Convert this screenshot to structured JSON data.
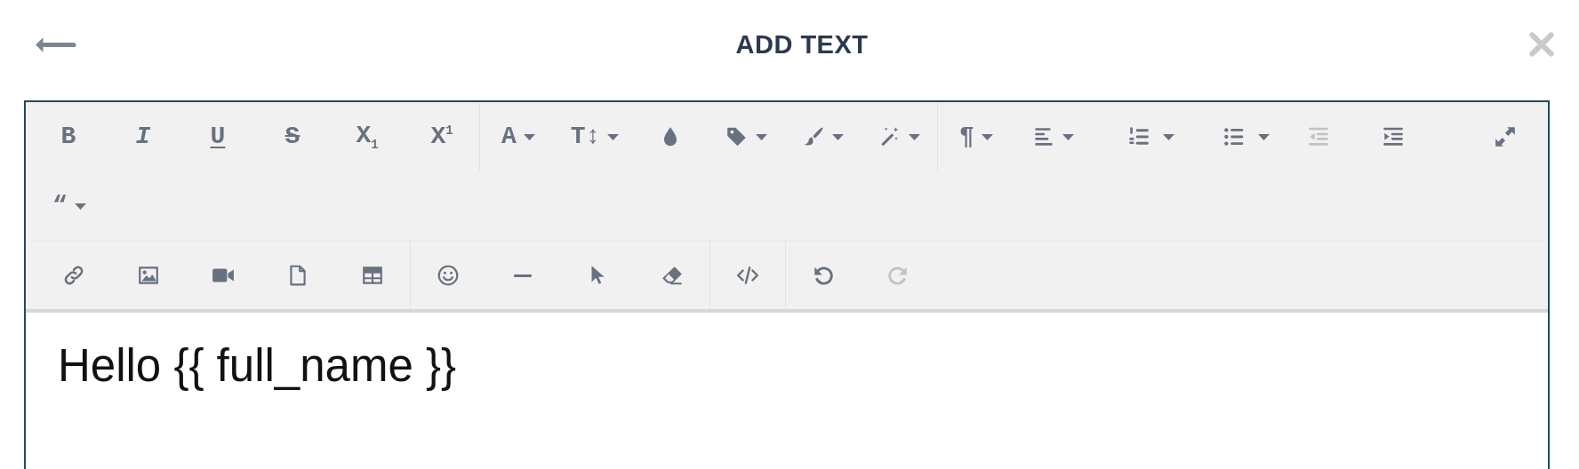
{
  "header": {
    "title": "ADD TEXT"
  },
  "toolbar": {
    "bars": [
      {
        "lines": [
          {
            "groups": [
              {
                "kind": "leading",
                "items": [
                  {
                    "kind": "bold",
                    "label": "B",
                    "menu": false,
                    "split": false,
                    "disabled": false
                  },
                  {
                    "kind": "italic",
                    "label": "I",
                    "menu": false,
                    "split": false,
                    "disabled": false
                  },
                  {
                    "kind": "underline",
                    "label": "U",
                    "menu": false,
                    "split": false,
                    "disabled": false
                  },
                  {
                    "kind": "strike",
                    "label": "S",
                    "menu": false,
                    "split": false,
                    "disabled": false
                  },
                  {
                    "kind": "glyph",
                    "label": "X$_{1}$",
                    "menu": false,
                    "split": false,
                    "disabled": false
                  },
                  {
                    "kind": "glyph",
                    "label": "X$^{1}$",
                    "menu": false,
                    "split": false,
                    "disabled": false
                  }
                ]
              },
              {
                "kind": "leading",
                "items": [
                  {
                    "kind": "glyph",
                    "label": "A",
                    "menu": true,
                    "split": false,
                    "disabled": false
                  },
                  {
                    "kind": "glyph",
                    "label": "T↕",
                    "menu": true,
                    "split": false,
                    "disabled": false
                  },
                  {
                    "kind": "icon",
                    "menu": false,
                    "split": false,
                    "disabled": false
                  },
                  {
                    "kind": "icon",
                    "menu": true,
                    "split": false,
                    "disabled": false
                  },
                  {
                    "kind": "icon",
                    "menu": true,
                    "split": false,
                    "disabled": false
                  },
                  {
                    "kind": "icon",
                    "menu": true,
                    "split": false,
                    "disabled": false
                  }
                ]
              },
              {
                "kind": "leading",
                "items": [
                  {
                    "kind": "glyph",
                    "label": "¶",
                    "menu": true,
                    "split": false,
                    "disabled": false
                  },
                  {
                    "kind": "icon",
                    "menu": true,
                    "split": false,
                    "disabled": false
                  },
                  {
                    "kind": "icon",
                    "menu": true,
                    "split": true,
                    "disabled": false
                  },
                  {
                    "kind": "icon",
                    "menu": true,
                    "split": true,
                    "disabled": false
                  },
                  {
                    "kind": "icon",
                    "menu": false,
                    "split": false,
                    "disabled": true
                  },
                  {
                    "kind": "icon",
                    "menu": false,
                    "split": false,
                    "disabled": false
                  }
                ]
              },
              {
                "kind": "trailing",
                "items": [
                  {
                    "kind": "icon",
                    "menu": false,
                    "split": false,
                    "disabled": false
                  }
                ]
              }
            ]
          },
          {
            "groups": [
              {
                "kind": "leading",
                "items": [
                  {
                    "kind": "bold",
                    "label": "“",
                    "menu": true,
                    "split": false,
                    "disabled": false
                  }
                ]
              }
            ]
          }
        ]
      },
      {
        "lines": [
          {
            "groups": [
              {
                "kind": "leading",
                "items": [
                  {
                    "kind": "icon",
                    "menu": false,
                    "split": false,
                    "disabled": false
                  },
                  {
                    "kind": "icon",
                    "menu": false,
                    "split": false,
                    "disabled": false
                  },
                  {
                    "kind": "icon",
                    "menu": false,
                    "split": false,
                    "disabled": false
                  },
                  {
                    "kind": "icon",
                    "menu": false,
                    "split": false,
                    "disabled": false
                  },
                  {
                    "kind": "icon",
                    "menu": false,
                    "split": false,
                    "disabled": false
                  }
                ]
              },
              {
                "kind": "leading",
                "items": [
                  {
                    "kind": "icon",
                    "menu": false,
                    "split": false,
                    "disabled": false
                  },
                  {
                    "kind": "icon",
                    "menu": false,
                    "split": false,
                    "disabled": false
                  },
                  {
                    "kind": "icon",
                    "menu": false,
                    "split": false,
                    "disabled": false
                  },
                  {
                    "kind": "icon",
                    "menu": false,
                    "split": false,
                    "disabled": false
                  }
                ]
              },
              {
                "kind": "leading",
                "items": [
                  {
                    "kind": "icon",
                    "menu": false,
                    "split": false,
                    "disabled": false
                  }
                ]
              },
              {
                "kind": "leading",
                "items": [
                  {
                    "kind": "icon",
                    "menu": false,
                    "split": false,
                    "disabled": false
                  },
                  {
                    "kind": "icon",
                    "menu": false,
                    "split": false,
                    "disabled": true
                  }
                ]
              }
            ]
          }
        ]
      }
    ]
  },
  "content": "Hello {{ full_name }}"
}
